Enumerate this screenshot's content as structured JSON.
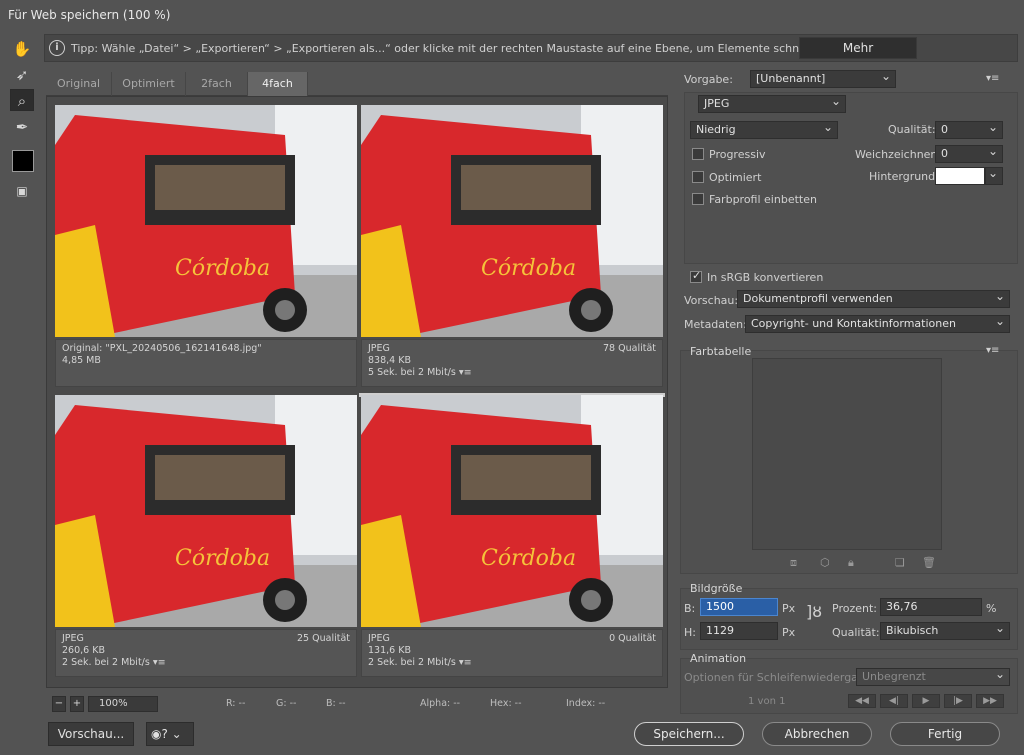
{
  "window": {
    "title": "Für Web speichern (100 %)"
  },
  "tip": {
    "text": "Tipp: Wähle „Datei“ > „Exportieren“ > „Exportieren als...“ oder klicke mit der rechten Maustaste auf eine Ebene, um Elemente schneller zu exportieren",
    "more_label": "Mehr"
  },
  "tabs": [
    {
      "label": "Original"
    },
    {
      "label": "Optimiert"
    },
    {
      "label": "2fach"
    },
    {
      "label": "4fach"
    }
  ],
  "active_tab": "4fach",
  "panes": [
    {
      "line1": "Original: \"PXL_20240506_162141648.jpg\"",
      "line2": "4,85 MB",
      "line3": "",
      "quality": ""
    },
    {
      "line1": "JPEG",
      "line2": "838,4 KB",
      "line3": "5 Sek. bei 2 Mbit/s",
      "quality": "78 Qualität"
    },
    {
      "line1": "JPEG",
      "line2": "260,6 KB",
      "line3": "2 Sek. bei 2 Mbit/s",
      "quality": "25 Qualität"
    },
    {
      "line1": "JPEG",
      "line2": "131,6 KB",
      "line3": "2 Sek. bei 2 Mbit/s",
      "quality": "0 Qualität"
    }
  ],
  "image_text": "Córdoba",
  "bottom": {
    "zoom": "100%",
    "r": "R: --",
    "g": "G: --",
    "b": "B: --",
    "alpha": "Alpha: --",
    "hex": "Hex: --",
    "index": "Index: --"
  },
  "settings": {
    "preset_label": "Vorgabe:",
    "preset_value": "[Unbenannt]",
    "format": "JPEG",
    "quality_preset": "Niedrig",
    "quality_label": "Qualität:",
    "quality_value": "0",
    "progressive_label": "Progressiv",
    "blur_label": "Weichzeichnen:",
    "blur_value": "0",
    "optimized_label": "Optimiert",
    "matte_label": "Hintergrund:",
    "embed_profile_label": "Farbprofil einbetten",
    "srgb_label": "In sRGB konvertieren",
    "preview_label": "Vorschau:",
    "preview_value": "Dokumentprofil verwenden",
    "metadata_label": "Metadaten:",
    "metadata_value": "Copyright- und Kontaktinformationen",
    "srgb_checked": true,
    "progressive_checked": false,
    "optimized_checked": false,
    "embed_checked": false
  },
  "color_table": {
    "title": "Farbtabelle"
  },
  "image_size": {
    "title": "Bildgröße",
    "w_label": "B:",
    "w_value": "1500",
    "w_unit": "Px",
    "h_label": "H:",
    "h_value": "1129",
    "h_unit": "Px",
    "percent_label": "Prozent:",
    "percent_value": "36,76",
    "percent_unit": "%",
    "quality_label": "Qualität:",
    "quality_value": "Bikubisch"
  },
  "animation": {
    "title": "Animation",
    "loop_label": "Optionen für Schleifenwiedergabe:",
    "loop_value": "Unbegrenzt",
    "frame_counter": "1 von 1"
  },
  "footer": {
    "preview_label": "Vorschau...",
    "save_label": "Speichern...",
    "cancel_label": "Abbrechen",
    "done_label": "Fertig"
  },
  "colors": {
    "bg": "#535353",
    "accent": "#2a5fa6",
    "bus_red": "#d8282c",
    "bus_yellow": "#f2c21b"
  }
}
